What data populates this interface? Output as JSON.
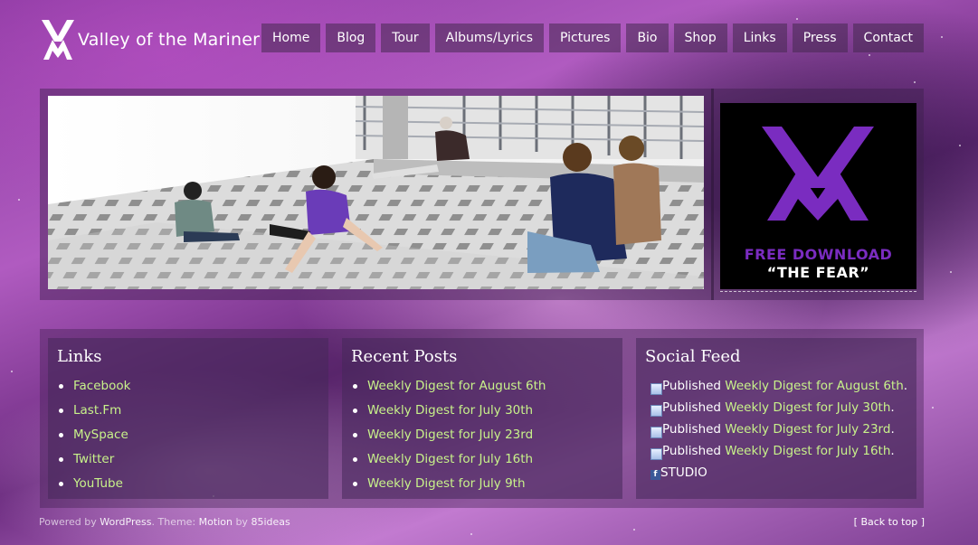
{
  "site": {
    "title": "Valley of the Mariner"
  },
  "nav": [
    "Home",
    "Blog",
    "Tour",
    "Albums/Lyrics",
    "Pictures",
    "Bio",
    "Shop",
    "Links",
    "Press",
    "Contact"
  ],
  "promo": {
    "line1": "FREE DOWNLOAD",
    "line2": "“THE FEAR”",
    "accent": "#7a2cc0"
  },
  "links_widget": {
    "title": "Links",
    "items": [
      "Facebook",
      "Last.Fm",
      "MySpace",
      "Twitter",
      "YouTube"
    ]
  },
  "recent_posts": {
    "title": "Recent Posts",
    "items": [
      "Weekly Digest for August 6th",
      "Weekly Digest for July 30th",
      "Weekly Digest for July 23rd",
      "Weekly Digest for July 16th",
      "Weekly Digest for July 9th"
    ]
  },
  "social_feed": {
    "title": "Social Feed",
    "verb": "Published",
    "items": [
      "Weekly Digest for August 6th",
      "Weekly Digest for July 30th",
      "Weekly Digest for July 23rd",
      "Weekly Digest for July 16th"
    ],
    "last": "STUDIO"
  },
  "footer": {
    "powered": "Powered by",
    "wordpress": "WordPress",
    "theme": "Theme:",
    "motion": "Motion",
    "by": "by",
    "author": "85ideas",
    "back_to_top": "[ Back to top ]"
  },
  "colors": {
    "link": "#c8f28a"
  }
}
